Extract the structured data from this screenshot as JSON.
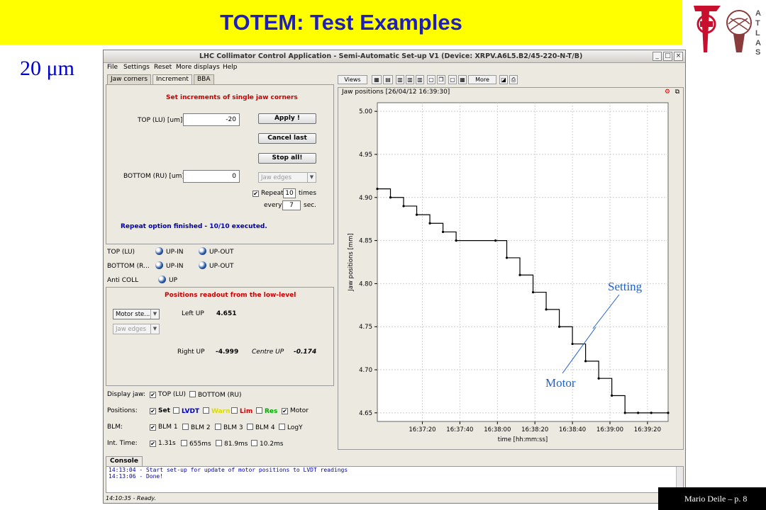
{
  "slide": {
    "title": "TOTEM: Test Examples",
    "scale_label": "20 μm",
    "footer": "Mario Deile – p. 8",
    "annotations": {
      "setting": "Setting",
      "motor": "Motor"
    },
    "logos": {
      "totem_letters": "TOTEM",
      "atlas_letters": [
        "A",
        "T",
        "L",
        "A",
        "S"
      ]
    }
  },
  "app": {
    "window_title": "LHC Collimator Control Application - Semi-Automatic Set-up V1 (Device: XRPV.A6L5.B2/45-220-N-T/B)",
    "window_buttons": [
      "_",
      "□",
      "×"
    ],
    "menu": [
      "File",
      "Settings",
      "Reset",
      "More displays",
      "Help"
    ],
    "left_tabs": [
      "Jaw corners",
      "Increment",
      "BBA"
    ],
    "increment": {
      "heading": "Set increments of single jaw corners",
      "top_label": "TOP (LU) [um]",
      "top_value": "-20",
      "bottom_label": "BOTTOM (RU) [um]",
      "bottom_value": "0",
      "apply": "Apply !",
      "cancel_last": "Cancel last",
      "stop_all": "Stop all!",
      "combo": "Jaw edges",
      "repeat_label": "Repeat",
      "repeat_count": "10",
      "times_label": "times",
      "every_label": "every",
      "every_value": "7",
      "sec_label": "sec.",
      "status": "Repeat option finished - 10/10 executed."
    },
    "jaw_status": [
      {
        "label": "TOP (LU)",
        "a": "UP-IN",
        "b": "UP-OUT"
      },
      {
        "label": "BOTTOM (R...",
        "a": "UP-IN",
        "b": "UP-OUT"
      },
      {
        "label": "Anti COLL",
        "a": "UP",
        "b": ""
      }
    ],
    "readout": {
      "heading": "Positions readout from the low-level",
      "combo1": "Motor ste...",
      "combo2": "Jaw edges",
      "left_up_label": "Left UP",
      "left_up_value": "4.651",
      "right_up_label": "Right UP",
      "right_up_value": "-4.999",
      "centre_up_label": "Centre UP",
      "centre_up_value": "-0.174"
    },
    "options": {
      "display_jaw_label": "Display jaw:",
      "display_jaw": [
        "TOP (LU)",
        "BOTTOM (RU)"
      ],
      "positions_label": "Positions:",
      "positions": [
        "Set",
        "LVDT",
        "Warn",
        "Lim",
        "Res",
        "Motor"
      ],
      "positions_colors": [
        "#000000",
        "#0000cc",
        "#dddd00",
        "#cc0000",
        "#00aa00",
        "#000000"
      ],
      "blm_label": "BLM:",
      "blm": [
        "BLM 1",
        "BLM 2",
        "BLM 3",
        "BLM 4",
        "LogY"
      ],
      "int_time_label": "Int. Time:",
      "int_time": [
        "1.31s",
        "655ms",
        "81.9ms",
        "10.2ms"
      ]
    },
    "toolbar": {
      "views": "Views",
      "more": "More"
    },
    "chart_header": "Jaw positions  [26/04/12 16:39:30]",
    "console_tab": "Console",
    "console_lines": [
      "14:13:04 - Start set-up for update of motor positions to LVDT readings",
      "14:13:06 - Done!"
    ],
    "status": "14:10:35 - Ready."
  },
  "chart_data": {
    "type": "line",
    "title": "",
    "xlabel": "time [hh:mm:ss]",
    "ylabel": "Jaw positions [mm]",
    "x_ticks": [
      "16:37:20",
      "16:37:40",
      "16:38:00",
      "16:38:20",
      "16:38:40",
      "16:39:00",
      "16:39:20"
    ],
    "y_ticks": [
      "5.00",
      "4.95",
      "4.90",
      "4.85",
      "4.80",
      "4.75",
      "4.70",
      "4.65"
    ],
    "xlim": [
      "16:36:56",
      "16:39:31"
    ],
    "ylim": [
      4.64,
      5.01
    ],
    "grid": true,
    "series": [
      {
        "color": "#000000",
        "x": [
          "16:36:56",
          "16:37:03",
          "16:37:10",
          "16:37:17",
          "16:37:24",
          "16:37:31",
          "16:37:38",
          "16:37:59",
          "16:38:05",
          "16:38:12",
          "16:38:19",
          "16:38:26",
          "16:38:33",
          "16:38:40",
          "16:38:47",
          "16:38:54",
          "16:39:01",
          "16:39:08",
          "16:39:15",
          "16:39:22",
          "16:39:31"
        ],
        "values": [
          4.91,
          4.9,
          4.89,
          4.88,
          4.87,
          4.86,
          4.85,
          4.85,
          4.83,
          4.81,
          4.79,
          4.77,
          4.75,
          4.73,
          4.71,
          4.69,
          4.67,
          4.65,
          4.65,
          4.65,
          4.65
        ]
      }
    ]
  }
}
